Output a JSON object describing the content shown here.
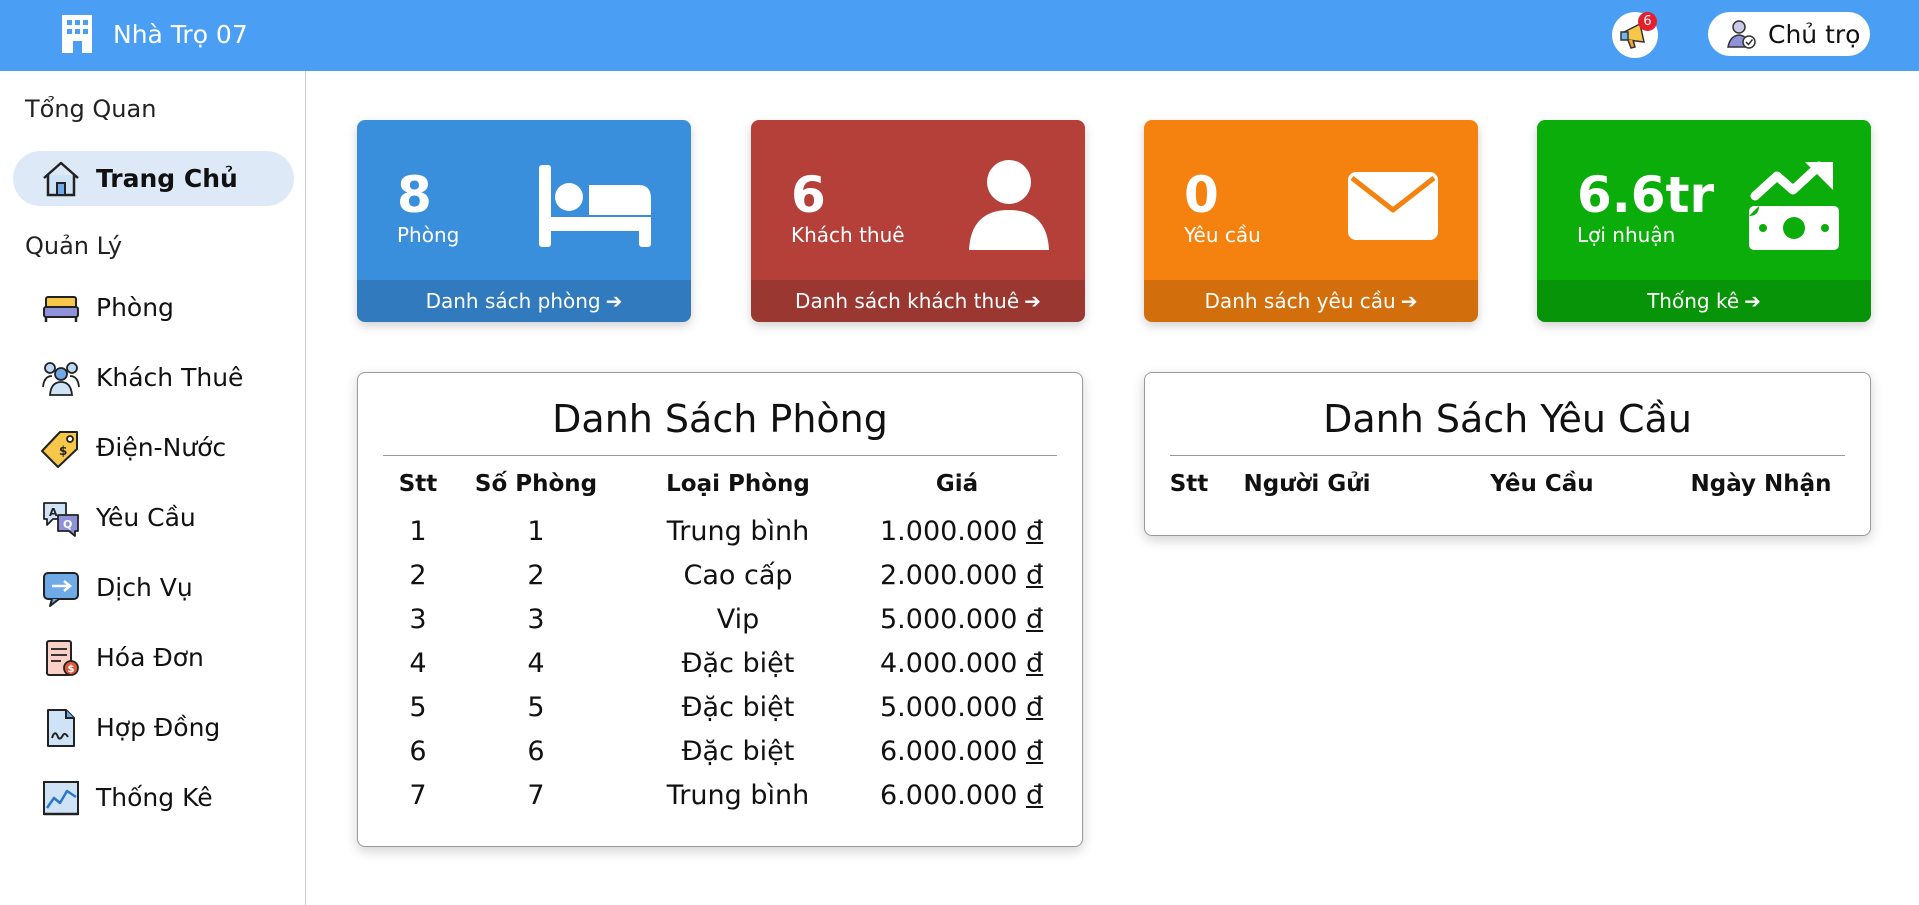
{
  "header": {
    "app_title": "Nhà Trọ 07",
    "brand_icon": "building-icon",
    "notification_count": "6",
    "user_label": "Chủ trọ",
    "colors": {
      "bar": "#4a9ff5"
    }
  },
  "sidebar": {
    "section_overview": "Tổng Quan",
    "section_manage": "Quản Lý",
    "items": [
      {
        "label": "Trang Chủ",
        "icon": "home-icon",
        "active": true
      },
      {
        "label": "Phòng",
        "icon": "bed-icon"
      },
      {
        "label": "Khách Thuê",
        "icon": "tenants-icon"
      },
      {
        "label": "Điện-Nước",
        "icon": "utility-tag-icon"
      },
      {
        "label": "Yêu Cầu",
        "icon": "request-chat-icon"
      },
      {
        "label": "Dịch Vụ",
        "icon": "service-icon"
      },
      {
        "label": "Hóa Đơn",
        "icon": "invoice-icon"
      },
      {
        "label": "Hợp Đồng",
        "icon": "contract-icon"
      },
      {
        "label": "Thống Kê",
        "icon": "statistics-chart-icon"
      }
    ]
  },
  "cards": [
    {
      "value": "8",
      "label": "Phòng",
      "link": "Danh sách phòng",
      "icon": "bed-icon",
      "color": "#3a8fdc"
    },
    {
      "value": "6",
      "label": "Khách thuê",
      "link": "Danh sách khách thuê",
      "icon": "user-icon",
      "color": "#b5403a"
    },
    {
      "value": "0",
      "label": "Yêu cầu",
      "link": "Danh sách yêu cầu",
      "icon": "envelope-icon",
      "color": "#f5820f"
    },
    {
      "value": "6.6tr",
      "label": "Lợi nhuận",
      "link": "Thống kê",
      "icon": "money-growth-icon",
      "color": "#0aad0a"
    }
  ],
  "rooms_panel": {
    "title": "Danh Sách Phòng",
    "headers": [
      "Stt",
      "Số Phòng",
      "Loại Phòng",
      "Giá"
    ],
    "currency": "đ",
    "rows": [
      [
        "1",
        "1",
        "Trung bình",
        "1.000.000"
      ],
      [
        "2",
        "2",
        "Cao cấp",
        "2.000.000"
      ],
      [
        "3",
        "3",
        "Vip",
        "5.000.000"
      ],
      [
        "4",
        "4",
        "Đặc biệt",
        "4.000.000"
      ],
      [
        "5",
        "5",
        "Đặc biệt",
        "5.000.000"
      ],
      [
        "6",
        "6",
        "Đặc biệt",
        "6.000.000"
      ],
      [
        "7",
        "7",
        "Trung bình",
        "6.000.000"
      ]
    ]
  },
  "requests_panel": {
    "title": "Danh Sách Yêu Cầu",
    "headers": [
      "Stt",
      "Người Gửi",
      "Yêu Cầu",
      "Ngày Nhận"
    ],
    "rows": []
  }
}
